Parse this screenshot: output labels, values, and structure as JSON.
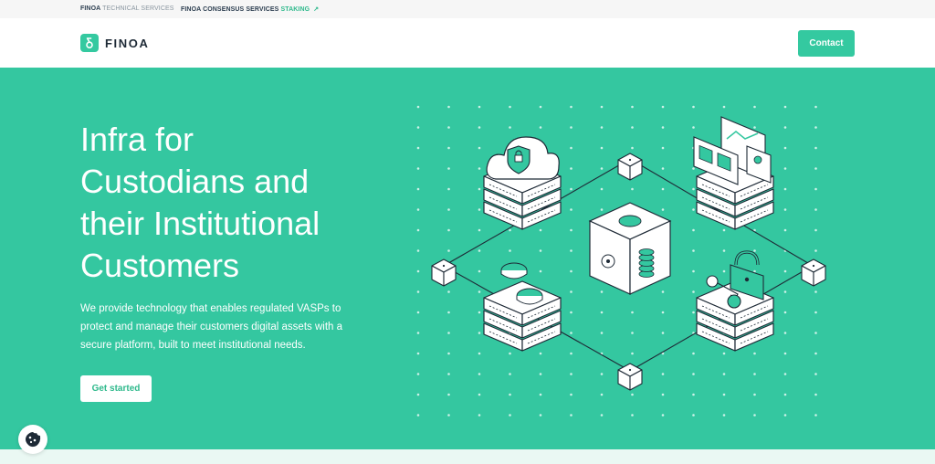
{
  "topbar": {
    "links": [
      {
        "brand": "FINOA",
        "label": "TECHNICAL SERVICES"
      },
      {
        "brand": "FINOA",
        "label": "CONSENSUS SERVICES",
        "highlight": "STAKING",
        "arrow": "↗"
      }
    ]
  },
  "nav": {
    "logo_text": "FINOA",
    "contact_label": "Contact"
  },
  "hero": {
    "headline_lines": [
      "Infra for",
      "Custodians and",
      "their Institutional",
      "Customers"
    ],
    "subtext": "We provide technology that enables regulated VASPs to protect and manage their customers digital assets with a secure platform, built to meet  institutional needs.",
    "cta_label": "Get started"
  },
  "colors": {
    "brand_green": "#34c7a0",
    "dark_text": "#1e2a36",
    "line": "#1e2a36"
  },
  "icons": {
    "logo": "finoa-logo-icon",
    "cookie": "cookie-icon",
    "external": "arrow-up-right-icon"
  }
}
